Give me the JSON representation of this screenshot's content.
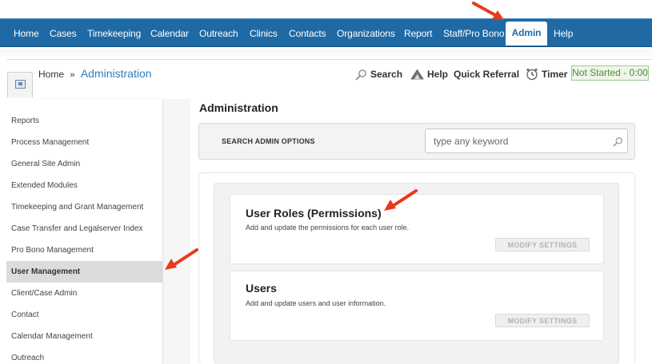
{
  "nav": {
    "items": [
      {
        "label": "Home"
      },
      {
        "label": "Cases"
      },
      {
        "label": "Timekeeping"
      },
      {
        "label": "Calendar"
      },
      {
        "label": "Outreach"
      },
      {
        "label": "Clinics"
      },
      {
        "label": "Contacts"
      },
      {
        "label": "Organizations"
      },
      {
        "label": "Report"
      },
      {
        "label": "Staff/Pro Bono"
      },
      {
        "label": "Admin",
        "active": true
      },
      {
        "label": "Help"
      }
    ]
  },
  "breadcrumb": {
    "home": "Home",
    "separator": "»",
    "current": "Administration"
  },
  "tools": {
    "search": "Search",
    "help": "Help",
    "quick_referral": "Quick Referral",
    "timer": "Timer",
    "timer_status": "Not Started - 0:00"
  },
  "sidebar": {
    "items": [
      {
        "label": "Reports"
      },
      {
        "label": "Process Management"
      },
      {
        "label": "General Site Admin"
      },
      {
        "label": "Extended Modules"
      },
      {
        "label": "Timekeeping and Grant Management"
      },
      {
        "label": "Case Transfer and Legalserver Index"
      },
      {
        "label": "Pro Bono Management"
      },
      {
        "label": "User Management",
        "active": true
      },
      {
        "label": "Client/Case Admin"
      },
      {
        "label": "Contact"
      },
      {
        "label": "Calendar Management"
      },
      {
        "label": "Outreach"
      }
    ]
  },
  "main": {
    "title": "Administration",
    "search_label": "SEARCH ADMIN OPTIONS",
    "search_placeholder": "type any keyword",
    "cards": [
      {
        "title": "User Roles (Permissions)",
        "description": "Add and update the permissions for each user role.",
        "button": "MODIFY SETTINGS"
      },
      {
        "title": "Users",
        "description": "Add and update users and user information.",
        "button": "MODIFY SETTINGS"
      }
    ]
  },
  "colors": {
    "nav_bg": "#1f6aa5",
    "link": "#2f7fb8",
    "annotation_arrow": "#e8391f",
    "timer_green": "#4d8a3f"
  }
}
